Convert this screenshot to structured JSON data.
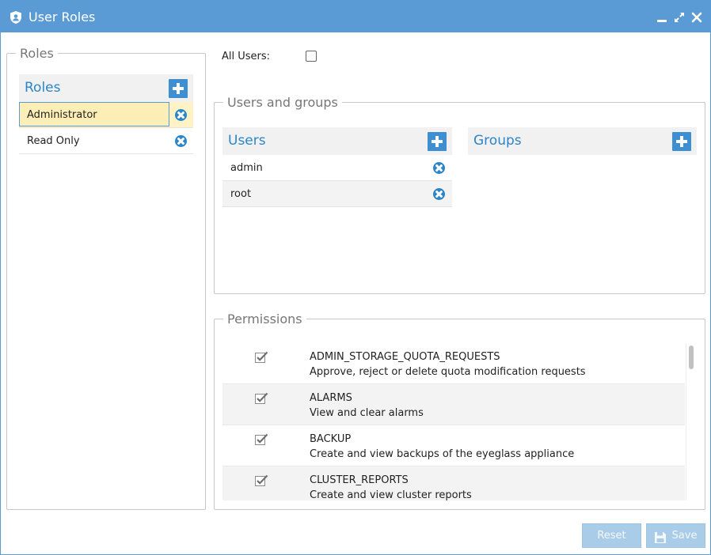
{
  "window": {
    "title": "User Roles",
    "icon": "shield-user-icon",
    "controls": [
      "minimize-icon",
      "maximize-icon",
      "close-icon"
    ]
  },
  "roles_section": {
    "legend": "Roles",
    "panel_title": "Roles",
    "items": [
      {
        "label": "Administrator",
        "selected": true
      },
      {
        "label": "Read Only",
        "selected": false
      }
    ]
  },
  "all_users": {
    "label": "All Users:",
    "checked": false
  },
  "users_groups_section": {
    "legend": "Users and groups",
    "users": {
      "title": "Users",
      "items": [
        {
          "label": "admin"
        },
        {
          "label": "root"
        }
      ]
    },
    "groups": {
      "title": "Groups",
      "items": []
    }
  },
  "permissions_section": {
    "legend": "Permissions",
    "items": [
      {
        "name": "ADMIN_STORAGE_QUOTA_REQUESTS",
        "description": "Approve, reject or delete quota modification requests",
        "checked": true
      },
      {
        "name": "ALARMS",
        "description": "View and clear alarms",
        "checked": true
      },
      {
        "name": "BACKUP",
        "description": "Create and view backups of the eyeglass appliance",
        "checked": true
      },
      {
        "name": "CLUSTER_REPORTS",
        "description": "Create and view cluster reports",
        "checked": true
      }
    ]
  },
  "footer": {
    "reset_label": "Reset",
    "save_label": "Save"
  },
  "colors": {
    "title_bar": "#5b9bd5",
    "accent": "#2a86c8",
    "selected_row": "#fff2c6",
    "disabled_button": "#a9cde9"
  }
}
